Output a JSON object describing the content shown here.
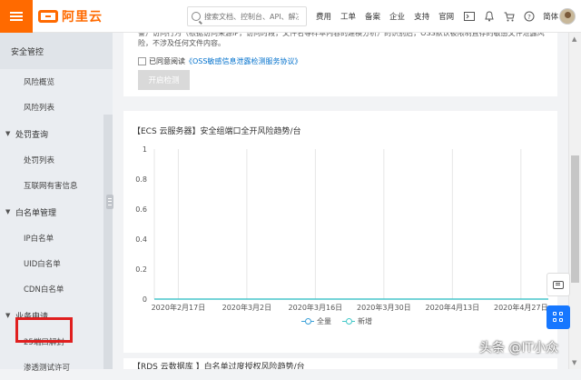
{
  "topbar": {
    "logo_text": "阿里云",
    "search_placeholder": "搜索文档、控制台、API、解决方案",
    "nav": [
      "费用",
      "工单",
      "备案",
      "企业",
      "支持",
      "官网"
    ],
    "language": "简体"
  },
  "sidebar": {
    "section_title": "安全管控",
    "items": [
      {
        "type": "sub",
        "label": "风险概览"
      },
      {
        "type": "sub",
        "label": "风险列表"
      },
      {
        "type": "group",
        "label": "处罚查询"
      },
      {
        "type": "sub",
        "label": "处罚列表"
      },
      {
        "type": "sub",
        "label": "互联网有害信息"
      },
      {
        "type": "group",
        "label": "白名单管理"
      },
      {
        "type": "sub",
        "label": "IP白名单"
      },
      {
        "type": "sub",
        "label": "UID白名单"
      },
      {
        "type": "sub",
        "label": "CDN白名单"
      },
      {
        "type": "group",
        "label": "业务申请"
      },
      {
        "type": "sub",
        "label": "25端口解封"
      },
      {
        "type": "sub",
        "label": "渗透测试许可"
      }
    ]
  },
  "notice": {
    "text": "警）访问行为（根据访问来源IP，访问时段，文件名等样本内容的建模分析）的识别后，OSS默认被限制直存的敏感文件泄露风险，不涉及任何文件内容。",
    "agree_prefix": "已同意阅读",
    "agree_link": "《OSS敏感信息泄露检测服务协议》",
    "start_button": "开启检测"
  },
  "chart_title": "【ECS 云服务器】安全组端口全开风险趋势/台",
  "next_section_title": "【RDS 云数据库 】白名单过度授权风险趋势/台",
  "chart_data": {
    "type": "line",
    "title": "【ECS 云服务器】安全组端口全开风险趋势/台",
    "xlabel": "",
    "ylabel": "",
    "ylim": [
      0,
      1
    ],
    "yticks": [
      "0",
      "0.2",
      "0.4",
      "0.6",
      "0.8",
      "1"
    ],
    "categories": [
      "2020年2月17日",
      "2020年3月2日",
      "2020年3月16日",
      "2020年3月30日",
      "2020年4月13日",
      "2020年4月27日"
    ],
    "series": [
      {
        "name": "全量",
        "values": [
          0,
          0,
          0,
          0,
          0,
          0
        ],
        "color": "#3ba0d8"
      },
      {
        "name": "新增",
        "values": [
          0,
          0,
          0,
          0,
          0,
          0
        ],
        "color": "#42c8c8"
      }
    ],
    "grid": true,
    "legend_position": "bottom"
  },
  "watermark": "头条 @IT小众",
  "colors": {
    "brand": "#ff6a00",
    "highlight": "#e01f1f",
    "link": "#0070cc",
    "fab_primary": "#1677ff"
  }
}
